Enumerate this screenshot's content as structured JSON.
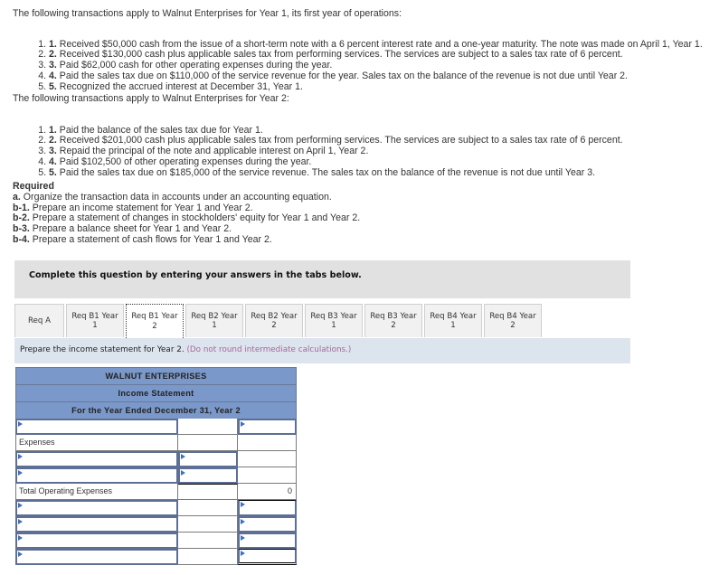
{
  "problem": {
    "year1_intro": "The following transactions apply to Walnut Enterprises for Year 1, its first year of operations:",
    "year1_transactions": [
      {
        "num": "1.",
        "text": "Received $50,000 cash from the issue of a short-term note with a 6 percent interest rate and a one-year maturity. The note was made on April 1, Year 1."
      },
      {
        "num": "2.",
        "text": "Received $130,000 cash plus applicable sales tax from performing services. The services are subject to a sales tax rate of 6 percent."
      },
      {
        "num": "3.",
        "text": "Paid $62,000 cash for other operating expenses during the year."
      },
      {
        "num": "4.",
        "text": "Paid the sales tax due on $110,000 of the service revenue for the year. Sales tax on the balance of the revenue is not due until Year 2."
      },
      {
        "num": "5.",
        "text": "Recognized the accrued interest at December 31, Year 1."
      }
    ],
    "year2_intro": "The following transactions apply to Walnut Enterprises for Year 2:",
    "year2_transactions": [
      {
        "num": "1.",
        "text": "Paid the balance of the sales tax due for Year 1."
      },
      {
        "num": "2.",
        "text": "Received $201,000 cash plus applicable sales tax from performing services. The services are subject to a sales tax rate of 6 percent."
      },
      {
        "num": "3.",
        "text": "Repaid the principal of the note and applicable interest on April 1, Year 2."
      },
      {
        "num": "4.",
        "text": "Paid $102,500 of other operating expenses during the year."
      },
      {
        "num": "5.",
        "text": "Paid the sales tax due on $185,000 of the service revenue. The sales tax on the balance of the revenue is not due until Year 3."
      }
    ],
    "required_heading": "Required",
    "required_items": [
      {
        "num": "a.",
        "text": "Organize the transaction data in accounts under an accounting equation."
      },
      {
        "num": "b-1.",
        "text": "Prepare an income statement for Year 1 and Year 2."
      },
      {
        "num": "b-2.",
        "text": "Prepare a statement of changes in stockholders' equity for Year 1 and Year 2."
      },
      {
        "num": "b-3.",
        "text": "Prepare a balance sheet for Year 1 and Year 2."
      },
      {
        "num": "b-4.",
        "text": "Prepare a statement of cash flows for Year 1 and Year 2."
      }
    ]
  },
  "banner": "Complete this question by entering your answers in the tabs below.",
  "tabs": [
    {
      "line1": "Req A",
      "line2": "",
      "active": false
    },
    {
      "line1": "Req B1 Year",
      "line2": "1",
      "active": false
    },
    {
      "line1": "Req B1 Year",
      "line2": "2",
      "active": true
    },
    {
      "line1": "Req B2 Year",
      "line2": "1",
      "active": false
    },
    {
      "line1": "Req B2 Year",
      "line2": "2",
      "active": false
    },
    {
      "line1": "Req B3 Year",
      "line2": "1",
      "active": false
    },
    {
      "line1": "Req B3 Year",
      "line2": "2",
      "active": false
    },
    {
      "line1": "Req B4 Year",
      "line2": "1",
      "active": false
    },
    {
      "line1": "Req B4 Year",
      "line2": "2",
      "active": false
    }
  ],
  "instruction": {
    "text": "Prepare the income statement for Year 2.",
    "hint": "(Do not round intermediate calculations.)"
  },
  "statement": {
    "company": "WALNUT ENTERPRISES",
    "title": "Income Statement",
    "period": "For the Year Ended December 31, Year 2",
    "expenses_label": "Expenses",
    "total_operating_expenses_label": "Total Operating Expenses",
    "total_operating_expenses_value": "0"
  },
  "colors": {
    "header_blue": "#7a98c9",
    "instruction_bg": "#dce4ee",
    "hint_purple": "#a8669a",
    "banner_gray": "#e1e1e1"
  }
}
